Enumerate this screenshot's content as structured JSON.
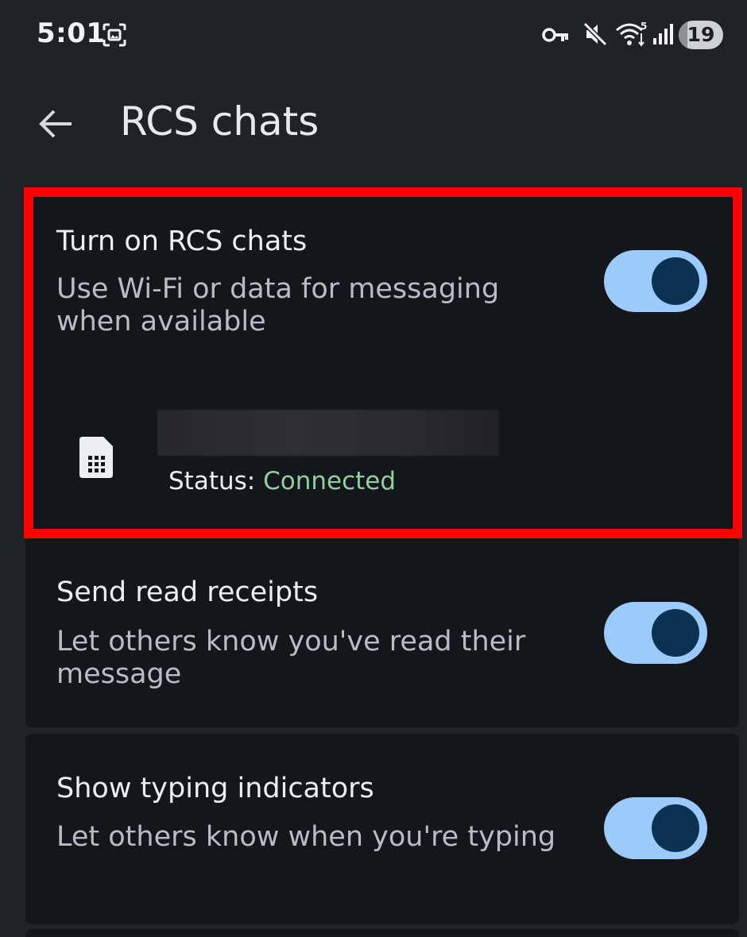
{
  "status_bar": {
    "time": "5:01",
    "battery_level": "19",
    "battery_fraction": 0.19,
    "wifi_badge": "5"
  },
  "app_bar": {
    "title": "RCS chats",
    "back_icon": "arrow-back-icon"
  },
  "settings": {
    "rcs": {
      "title": "Turn on RCS chats",
      "subtitle": "Use Wi-Fi or data for messaging when available",
      "enabled": true,
      "sim": {
        "icon": "sim-card-icon",
        "status_label": "Status:",
        "status_value": "Connected",
        "status_color": "#8fd19e"
      }
    },
    "read_receipts": {
      "title": "Send read receipts",
      "subtitle": "Let others know you've read their message",
      "enabled": true
    },
    "typing_indicators": {
      "title": "Show typing indicators",
      "subtitle": "Let others know when you're typing",
      "enabled": true
    }
  },
  "colors": {
    "background": "#1f2226",
    "card": "#13161a",
    "toggle_track_on": "#9ccbfb",
    "toggle_knob_on": "#0b3252",
    "highlight": "#ff0000"
  }
}
